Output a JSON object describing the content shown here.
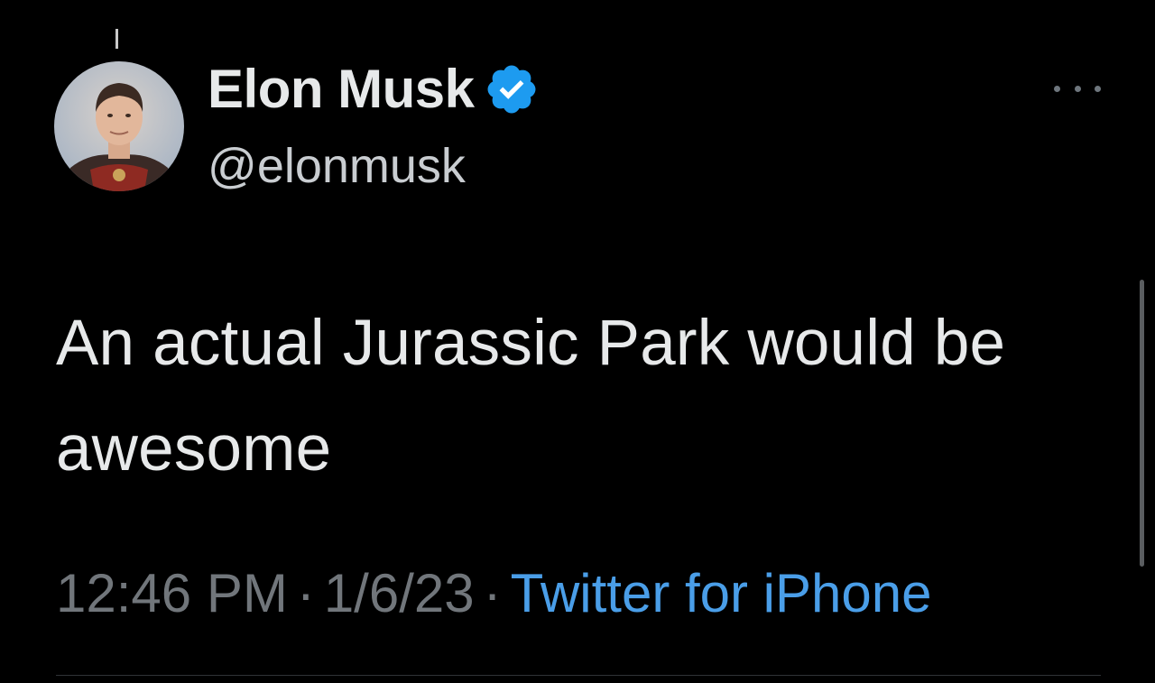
{
  "tweet": {
    "author": {
      "display_name": "Elon Musk",
      "handle": "@elonmusk",
      "verified": true,
      "avatar_icon": "profile-photo"
    },
    "text": "An actual Jurassic Park would be awesome",
    "meta": {
      "time": "12:46 PM",
      "separator": "·",
      "date": "1/6/23",
      "source": "Twitter for iPhone"
    }
  },
  "icons": {
    "verified": "verified-badge-icon",
    "more": "more-options-icon"
  },
  "colors": {
    "background": "#000000",
    "primary_text": "#e7e9ea",
    "secondary_text": "#71767b",
    "link": "#4a9ee8",
    "verified_badge": "#1d9bf0"
  }
}
